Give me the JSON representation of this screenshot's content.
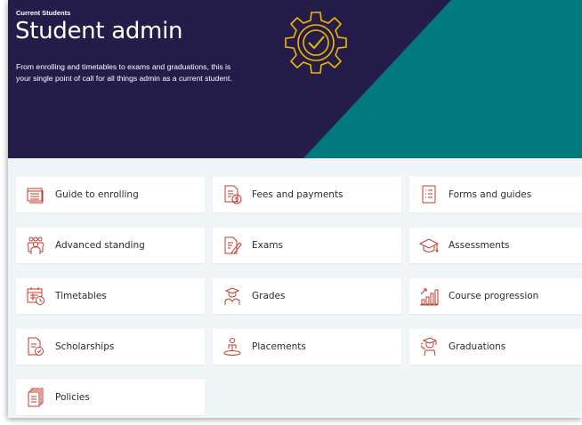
{
  "hero": {
    "eyebrow": "Current Students",
    "title": "Student admin",
    "description": "From enrolling and timetables to exams and graduations, this is your single point of call for all things admin as a current student.",
    "colors": {
      "background": "#241d4a",
      "teal": "#00797f",
      "gear": "#f2b705"
    }
  },
  "cards": [
    {
      "label": "Guide to enrolling",
      "icon": "calendar-list-icon"
    },
    {
      "label": "Fees and payments",
      "icon": "invoice-dollar-icon"
    },
    {
      "label": "Forms and guides",
      "icon": "document-list-icon"
    },
    {
      "label": "Advanced standing",
      "icon": "people-group-icon"
    },
    {
      "label": "Exams",
      "icon": "exam-pencil-icon"
    },
    {
      "label": "Assessments",
      "icon": "graduation-cap-icon"
    },
    {
      "label": "Timetables",
      "icon": "calendar-clock-icon"
    },
    {
      "label": "Grades",
      "icon": "graduate-person-icon"
    },
    {
      "label": "Course progression",
      "icon": "bar-chart-arrow-icon"
    },
    {
      "label": "Scholarships",
      "icon": "document-check-icon"
    },
    {
      "label": "Placements",
      "icon": "person-location-icon"
    },
    {
      "label": "Graduations",
      "icon": "graduate-celebration-icon"
    },
    {
      "label": "Policies",
      "icon": "stacked-documents-icon"
    }
  ],
  "icon_color": "#c0392b"
}
